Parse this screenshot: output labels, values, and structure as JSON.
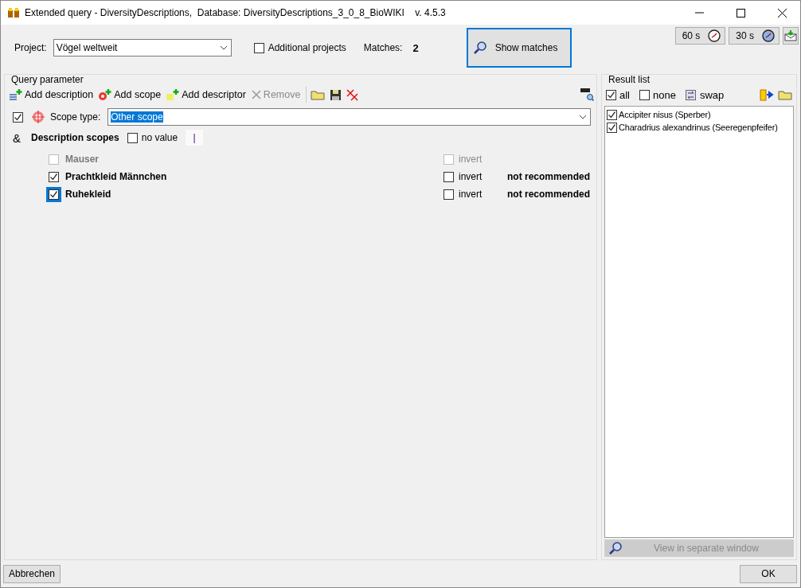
{
  "window": {
    "title": "Extended query - DiversityDescriptions,  Database: DiversityDescriptions_3_0_8_BioWIKI    v. 4.5.3"
  },
  "top": {
    "project_label": "Project:",
    "project_value": "Vögel weltweit",
    "additional_projects": {
      "label": "Additional projects",
      "checked": false
    },
    "matches_label": "Matches:",
    "matches_value": "2",
    "show_matches": "Show matches",
    "timers": [
      "60 s",
      "30 s"
    ]
  },
  "query_parameter": {
    "title": "Query parameter",
    "toolbar": [
      {
        "kind": "description",
        "label": "Add description",
        "disabled": false
      },
      {
        "kind": "scope",
        "label": "Add scope",
        "disabled": false
      },
      {
        "kind": "descriptor",
        "label": "Add descriptor",
        "disabled": false
      },
      {
        "kind": "remove",
        "label": "Remove",
        "disabled": true
      }
    ],
    "scope_type": {
      "checked": true,
      "label": "Scope type:",
      "value": "Other scope"
    },
    "description_scopes": {
      "operator": "&",
      "label": "Description scopes",
      "no_value": {
        "label": "no value",
        "checked": false
      },
      "cursor": "|"
    },
    "scopes": [
      {
        "name": "Mauser",
        "checked": false,
        "disabled": true,
        "focused": false,
        "invert": {
          "label": "invert",
          "checked": false
        }
      },
      {
        "name": "Prachtkleid Männchen",
        "checked": true,
        "disabled": false,
        "focused": false,
        "invert": {
          "label": "invert",
          "checked": false
        },
        "note": "not recommended"
      },
      {
        "name": "Ruhekleid",
        "checked": true,
        "disabled": false,
        "focused": true,
        "invert": {
          "label": "invert",
          "checked": false
        },
        "note": "not recommended"
      }
    ]
  },
  "result_list": {
    "title": "Result list",
    "all": {
      "label": "all",
      "checked": true
    },
    "none": {
      "label": "none",
      "checked": false
    },
    "swap": "swap",
    "items": [
      {
        "label": "Accipiter nisus (Sperber)",
        "checked": true
      },
      {
        "label": "Charadrius alexandrinus (Seeregenpfeifer)",
        "checked": true
      }
    ],
    "view_button": {
      "label": "View in separate window",
      "disabled": true
    }
  },
  "buttons": {
    "cancel": "Abbrechen",
    "ok": "OK"
  }
}
